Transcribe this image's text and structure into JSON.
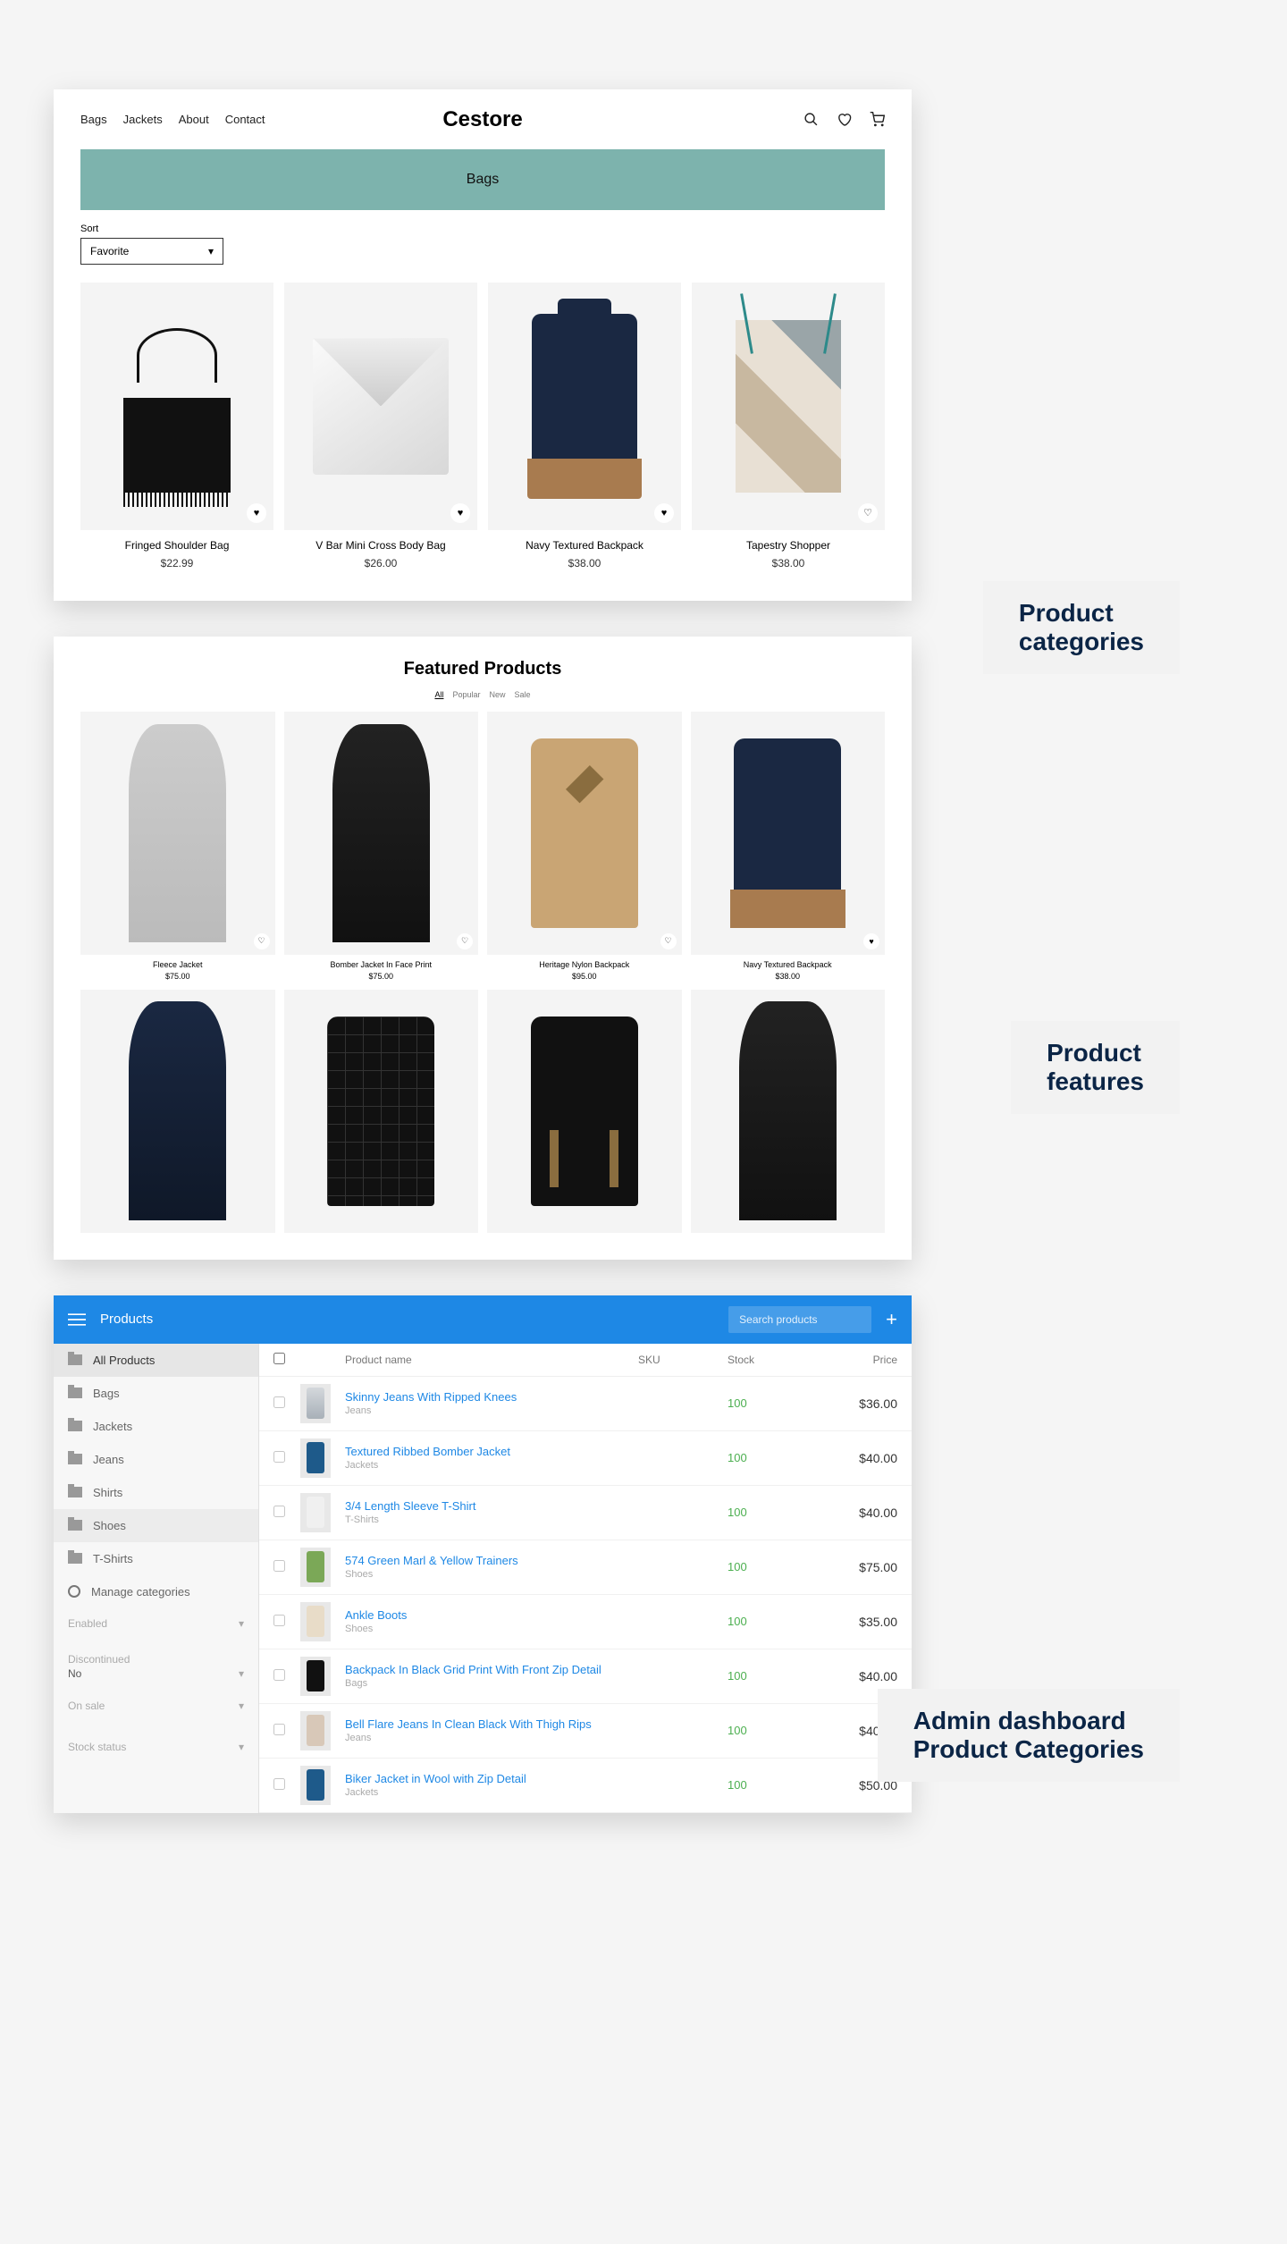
{
  "labels": {
    "section1": "Product\ncategories",
    "section2": "Product\nfeatures",
    "section3": "Admin dashboard\nProduct Categories"
  },
  "panel1": {
    "logo": "Cestore",
    "nav": [
      "Bags",
      "Jackets",
      "About",
      "Contact"
    ],
    "banner": "Bags",
    "sort_label": "Sort",
    "sort_value": "Favorite",
    "products": [
      {
        "name": "Fringed Shoulder Bag",
        "price": "$22.99"
      },
      {
        "name": "V Bar Mini Cross Body Bag",
        "price": "$26.00"
      },
      {
        "name": "Navy Textured Backpack",
        "price": "$38.00"
      },
      {
        "name": "Tapestry Shopper",
        "price": "$38.00"
      }
    ]
  },
  "panel2": {
    "title": "Featured Products",
    "tabs": [
      "All",
      "Popular",
      "New",
      "Sale"
    ],
    "products_row1": [
      {
        "name": "Fleece Jacket",
        "price": "$75.00"
      },
      {
        "name": "Bomber Jacket In Face Print",
        "price": "$75.00"
      },
      {
        "name": "Heritage Nylon Backpack",
        "price": "$95.00"
      },
      {
        "name": "Navy Textured Backpack",
        "price": "$38.00"
      }
    ]
  },
  "panel3": {
    "header_title": "Products",
    "search_placeholder": "Search products",
    "side_items": [
      "All Products",
      "Bags",
      "Jackets",
      "Jeans",
      "Shirts",
      "Shoes",
      "T-Shirts"
    ],
    "manage_label": "Manage categories",
    "filters": {
      "enabled": "Enabled",
      "discontinued": "Discontinued",
      "discontinued_value": "No",
      "onsale": "On sale",
      "stock": "Stock status"
    },
    "columns": {
      "name": "Product name",
      "sku": "SKU",
      "stock": "Stock",
      "price": "Price"
    },
    "rows": [
      {
        "title": "Skinny Jeans With Ripped Knees",
        "cat": "Jeans",
        "stock": "100",
        "price": "$36.00"
      },
      {
        "title": "Textured Ribbed Bomber Jacket",
        "cat": "Jackets",
        "stock": "100",
        "price": "$40.00"
      },
      {
        "title": "3/4 Length Sleeve T-Shirt",
        "cat": "T-Shirts",
        "stock": "100",
        "price": "$40.00"
      },
      {
        "title": "574 Green Marl & Yellow Trainers",
        "cat": "Shoes",
        "stock": "100",
        "price": "$75.00"
      },
      {
        "title": "Ankle Boots",
        "cat": "Shoes",
        "stock": "100",
        "price": "$35.00"
      },
      {
        "title": "Backpack In Black Grid Print With Front Zip Detail",
        "cat": "Bags",
        "stock": "100",
        "price": "$40.00"
      },
      {
        "title": "Bell Flare Jeans In Clean Black With Thigh Rips",
        "cat": "Jeans",
        "stock": "100",
        "price": "$40.00"
      },
      {
        "title": "Biker Jacket in Wool with Zip Detail",
        "cat": "Jackets",
        "stock": "100",
        "price": "$50.00"
      }
    ]
  }
}
